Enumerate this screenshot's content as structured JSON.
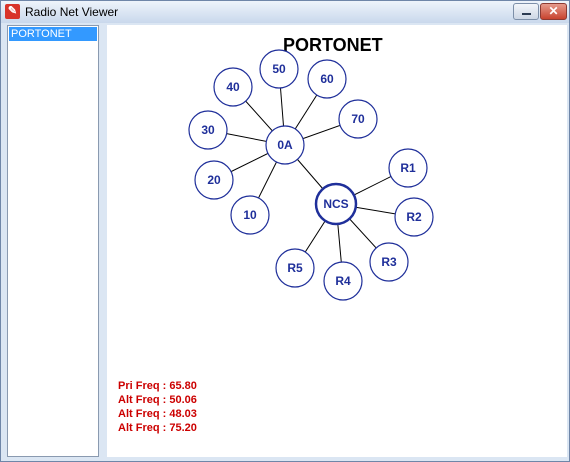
{
  "window": {
    "title": "Radio Net Viewer"
  },
  "sidebar": {
    "items": [
      {
        "label": "PORTONET",
        "selected": true
      }
    ]
  },
  "network": {
    "title": "PORTONET",
    "node_color": "#1f2f9a",
    "hub_nodes": [
      "0A",
      "NCS"
    ],
    "nodes_0A": [
      "50",
      "60",
      "40",
      "70",
      "30",
      "20",
      "10"
    ],
    "nodes_NCS": [
      "R1",
      "R2",
      "R3",
      "R4",
      "R5"
    ]
  },
  "frequencies": [
    {
      "label": "Pri Freq : 65.80"
    },
    {
      "label": "Alt Freq : 50.06"
    },
    {
      "label": "Alt Freq : 48.03"
    },
    {
      "label": "Alt Freq : 75.20"
    }
  ],
  "colors": {
    "freq_text": "#cc0000",
    "selection": "#3399ff"
  }
}
